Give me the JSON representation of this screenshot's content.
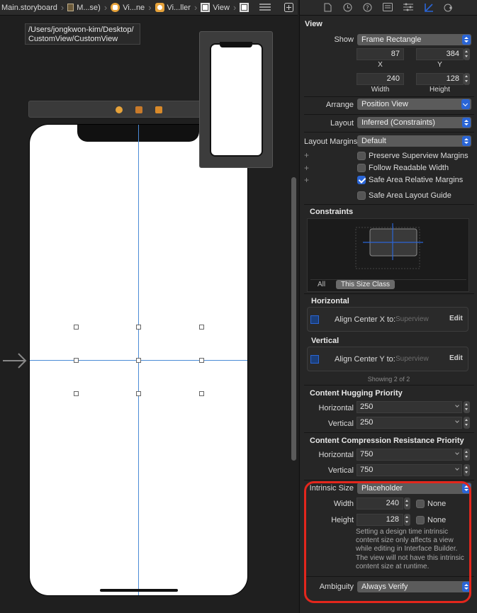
{
  "jumpbar": {
    "items": [
      "Main.storyboard",
      "M...se)",
      "Vi...ne",
      "Vi...ller",
      "View"
    ]
  },
  "canvas": {
    "path_tooltip": [
      "/Users/jongkwon-kim/Desktop/",
      "CustomView/CustomView"
    ]
  },
  "inspector": {
    "section_view": "View",
    "show_label": "Show",
    "show_value": "Frame Rectangle",
    "x_value": "87",
    "y_value": "384",
    "x_label": "X",
    "y_label": "Y",
    "width_value": "240",
    "height_value": "128",
    "width_label": "Width",
    "height_label": "Height",
    "arrange_label": "Arrange",
    "arrange_value": "Position View",
    "layout_label": "Layout",
    "layout_value": "Inferred (Constraints)",
    "margins_label": "Layout Margins",
    "margins_value": "Default",
    "checkboxes": [
      {
        "label": "Preserve Superview Margins",
        "checked": false
      },
      {
        "label": "Follow Readable Width",
        "checked": false
      },
      {
        "label": "Safe Area Relative Margins",
        "checked": true
      },
      {
        "label": "Safe Area Layout Guide",
        "checked": false
      }
    ],
    "constraints_title": "Constraints",
    "seg_all": "All",
    "seg_size_class": "This Size Class",
    "horizontal_title": "Horizontal",
    "horizontal_constraint": "Align Center X to:",
    "horizontal_target": "Superview",
    "vertical_title": "Vertical",
    "vertical_constraint": "Align Center Y to:",
    "vertical_target": "Superview",
    "edit_label": "Edit",
    "showing": "Showing 2 of 2",
    "hugging_title": "Content Hugging Priority",
    "hug_h_label": "Horizontal",
    "hug_h_value": "250",
    "hug_v_label": "Vertical",
    "hug_v_value": "250",
    "compression_title": "Content Compression Resistance Priority",
    "comp_h_label": "Horizontal",
    "comp_h_value": "750",
    "comp_v_label": "Vertical",
    "comp_v_value": "750",
    "intrinsic_label": "Intrinsic Size",
    "intrinsic_value": "Placeholder",
    "i_width_label": "Width",
    "i_width_value": "240",
    "i_height_label": "Height",
    "i_height_value": "128",
    "none_label": "None",
    "help_text": "Setting a design time intrinsic content size only affects a view while editing in Interface Builder. The view will not have this intrinsic content size at runtime.",
    "ambiguity_label": "Ambiguity",
    "ambiguity_value": "Always Verify"
  },
  "colors": {
    "accent": "#2a65d6",
    "highlight": "#e3261c",
    "guide": "#4b8bd6"
  }
}
